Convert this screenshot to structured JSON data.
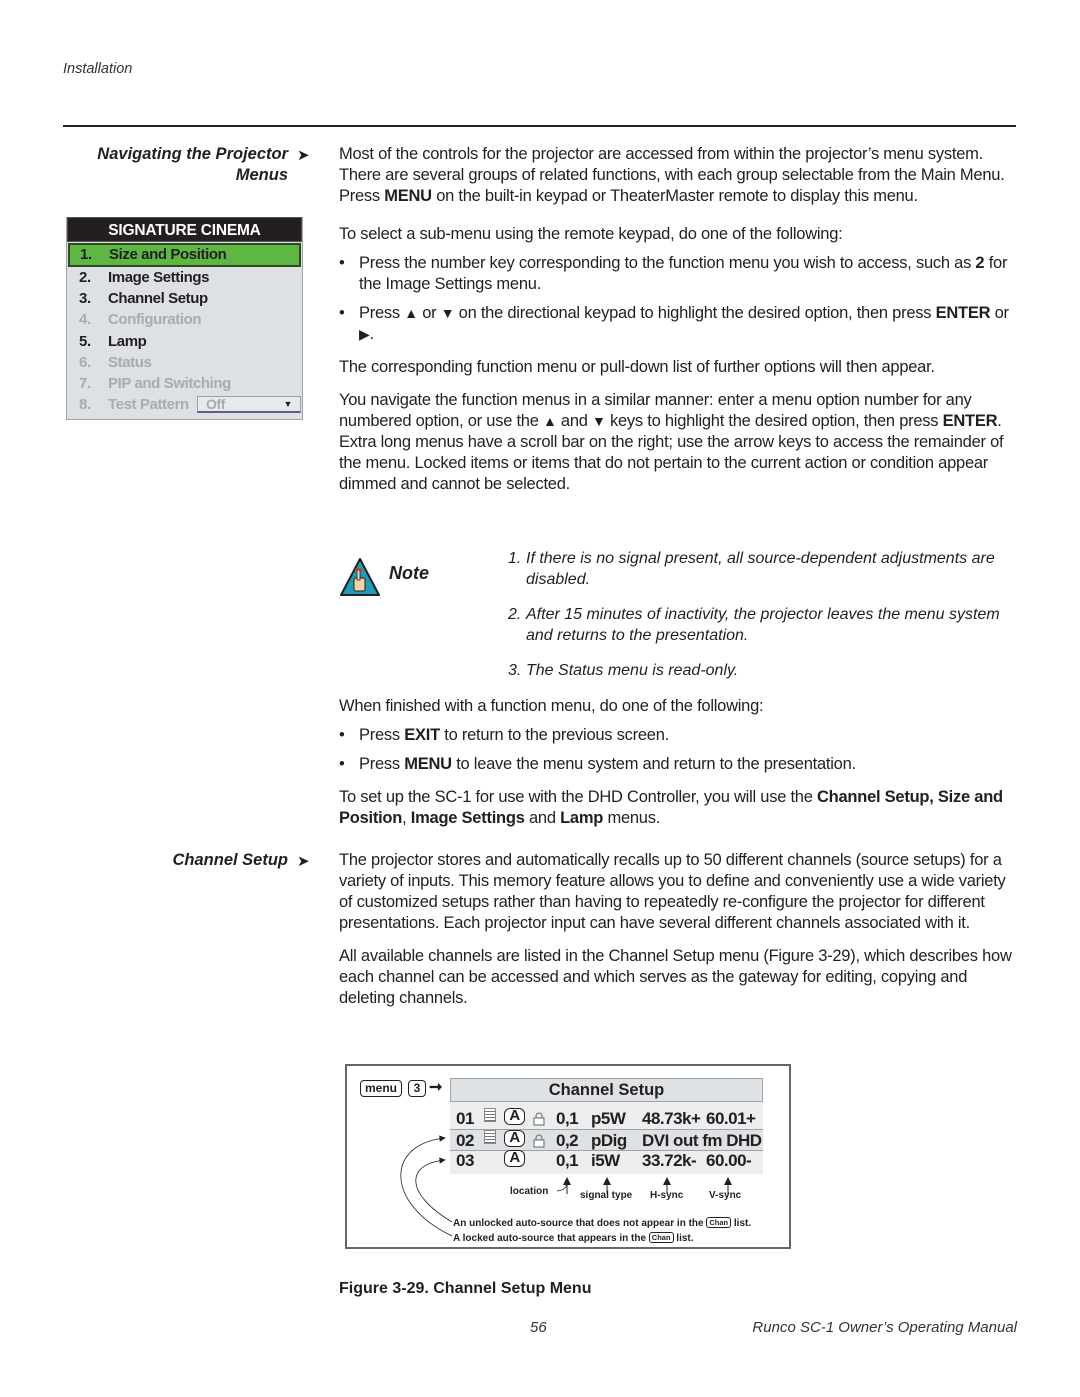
{
  "header": {
    "section": "Installation"
  },
  "sections": {
    "navigating": {
      "title_line1": "Navigating the Projector",
      "title_line2": "Menus"
    },
    "channel_setup": {
      "title": "Channel Setup"
    }
  },
  "signature_menu": {
    "title": "SIGNATURE CINEMA",
    "items": [
      {
        "num": "1.",
        "label": "Size and Position",
        "state": "selected"
      },
      {
        "num": "2.",
        "label": "Image Settings",
        "state": "enabled"
      },
      {
        "num": "3.",
        "label": "Channel Setup",
        "state": "enabled"
      },
      {
        "num": "4.",
        "label": "Configuration",
        "state": "dimmed"
      },
      {
        "num": "5.",
        "label": "Lamp",
        "state": "enabled"
      },
      {
        "num": "6.",
        "label": "Status",
        "state": "dimmed"
      },
      {
        "num": "7.",
        "label": "PIP and Switching",
        "state": "dimmed"
      },
      {
        "num": "8.",
        "label": "Test Pattern",
        "state": "dimmed",
        "dropdown_value": "Off"
      }
    ],
    "colors": {
      "selected_bg": "#5fb743",
      "title_bg": "#231f20",
      "dim_text": "#a6acb0"
    }
  },
  "body": {
    "p1": {
      "a": "Most of the controls for the projector are accessed from within the projector’s menu system. There are several groups of related functions, with each group selectable from the Main Menu. Press ",
      "b1": "MENU",
      "c": " on the built-in keypad or TheaterMaster remote to display this menu."
    },
    "p2": "To select a sub-menu using the remote keypad, do one of the following:",
    "bullet1": {
      "b1": "Press the number key corresponding to the function menu you wish to access, such as ",
      "bold": "2",
      "b2": " for the Image Settings menu."
    },
    "bullet2": {
      "b1": "Press ",
      "up": "▲",
      "or": " or ",
      "down": "▼",
      "b2": " on the directional keypad to highlight the desired option, then press ",
      "bold": "ENTER",
      "b3": " or ",
      "right": "▶",
      "b4": "."
    },
    "p3": "The corresponding function menu or pull-down list of further options will then appear.",
    "p4": {
      "a": "You navigate the function menus in a similar manner: enter a menu option number for any numbered option, or use the ",
      "up": "▲",
      "and": " and ",
      "down": "▼",
      "b": " keys to highlight the desired option, then press ",
      "bold": "ENTER",
      "c": ". Extra long menus have a scroll bar on the right; use the arrow keys to access the remainder of the menu. Locked items or items that do not pertain to the current action or condition appear dimmed and cannot be selected."
    },
    "note": {
      "label": "Note",
      "items": [
        {
          "n": "1.",
          "text": "If there is no signal present, all source-dependent adjustments are disabled."
        },
        {
          "n": "2.",
          "text": "After 15 minutes of inactivity, the projector leaves the menu system and returns to the presentation."
        },
        {
          "n": "3.",
          "text": "The Status menu is read-only."
        }
      ]
    },
    "p5": "When finished with a function menu, do one of the following:",
    "bullet3": {
      "a": "Press ",
      "bold": "EXIT",
      "b": " to return to the previous screen."
    },
    "bullet4": {
      "a": "Press ",
      "bold": "MENU",
      "b": " to leave the menu system and return to the presentation."
    },
    "p6": {
      "a": "To set up the SC-1 for use with the DHD Controller, you will use the ",
      "b1": "Channel Setup, Size and Position",
      "c": ", ",
      "b2": "Image Settings",
      "d": " and ",
      "b3": "Lamp",
      "e": " menus."
    },
    "p7": "The projector stores and automatically recalls up to 50 different channels (source setups) for a variety of inputs. This memory feature allows you to define and conveniently use a wide variety of customized setups rather than having to repeatedly re-configure the projector for different presentations. Each projector input can have several different channels associated with it.",
    "p8": "All available channels are listed in the Channel Setup menu (Figure 3-29), which describes how each channel can be accessed and which serves as the gateway for editing, copying and deleting channels."
  },
  "figure": {
    "key_menu": "menu",
    "key_3": "3",
    "title": "Channel Setup",
    "rows": [
      {
        "num": "01",
        "list_icon": true,
        "auto": "A",
        "lock": true,
        "location": "0,1",
        "signal": "p5W",
        "hsync": "48.73k+",
        "vsync": "60.01+"
      },
      {
        "num": "02",
        "list_icon": true,
        "auto": "A",
        "lock": true,
        "location": "0,2",
        "signal": "pDig",
        "desc": "DVI out fm DHD"
      },
      {
        "num": "03",
        "list_icon": false,
        "auto": "A",
        "lock": false,
        "location": "0,1",
        "signal": "i5W",
        "hsync": "33.72k-",
        "vsync": "60.00-"
      }
    ],
    "annotations": {
      "location": "location",
      "signal_type": "signal type",
      "hsync": "H-sync",
      "vsync": "V-sync",
      "unlocked_a": "An unlocked auto-source that does not appear in the ",
      "unlocked_chip": "Chan",
      "unlocked_b": " list.",
      "locked_a": "A locked auto-source that appears in the ",
      "locked_chip": "Chan",
      "locked_b": " list."
    },
    "caption": "Figure 3-29. Channel Setup Menu"
  },
  "footer": {
    "page": "56",
    "title": "Runco SC-1 Owner’s Operating Manual"
  }
}
